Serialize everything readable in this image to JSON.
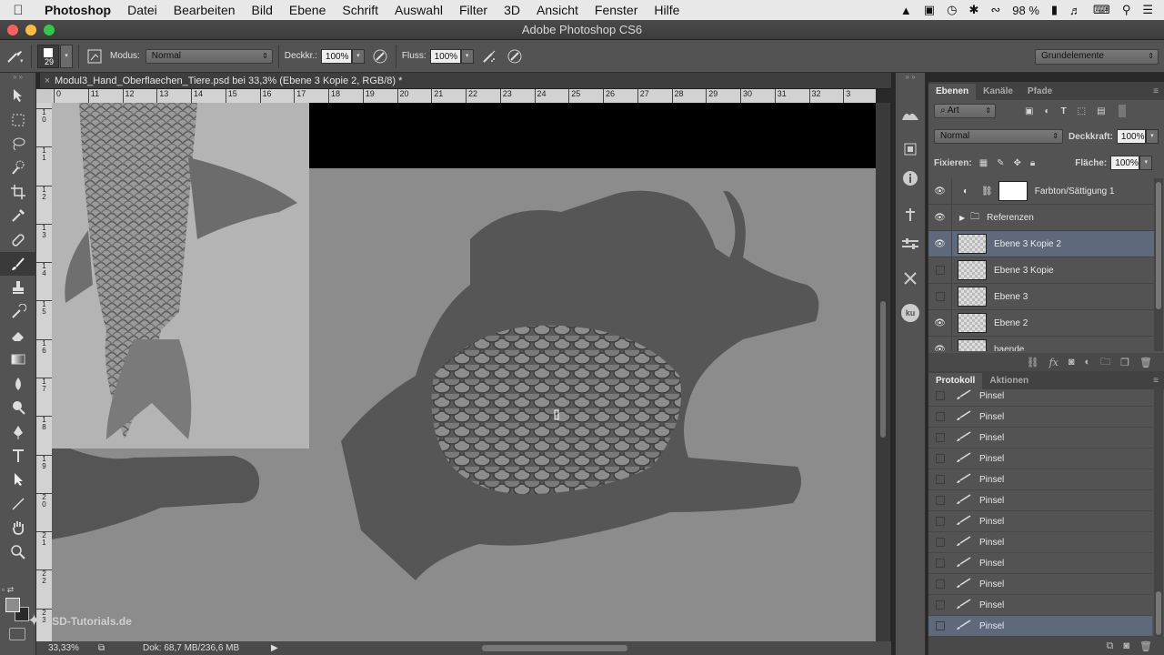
{
  "menubar": {
    "app_name": "Photoshop",
    "items": [
      "Datei",
      "Bearbeiten",
      "Bild",
      "Ebene",
      "Schrift",
      "Auswahl",
      "Filter",
      "3D",
      "Ansicht",
      "Fenster",
      "Hilfe"
    ],
    "battery": "98 %"
  },
  "window": {
    "title": "Adobe Photoshop CS6",
    "light_colors": [
      "#fc605c",
      "#fdbc40",
      "#34c84a"
    ]
  },
  "options": {
    "brush_size": "29",
    "mode_label": "Modus:",
    "mode_value": "Normal",
    "opacity_label": "Deckkr.:",
    "opacity_value": "100%",
    "flow_label": "Fluss:",
    "flow_value": "100%",
    "workspace": "Grundelemente"
  },
  "document": {
    "tab_title": "Modul3_Hand_Oberflaechen_Tiere.psd bei 33,3% (Ebene 3 Kopie 2, RGB/8) *",
    "ruler_h": [
      "0",
      "11",
      "12",
      "13",
      "14",
      "15",
      "16",
      "17",
      "18",
      "19",
      "20",
      "21",
      "22",
      "23",
      "24",
      "25",
      "26",
      "27",
      "28",
      "29",
      "30",
      "31",
      "32",
      "3"
    ],
    "ruler_v": [
      "1\n0",
      "1\n1",
      "1\n2",
      "1\n3",
      "1\n4",
      "1\n5",
      "1\n6",
      "1\n7",
      "1\n8",
      "1\n9",
      "2\n0",
      "2\n1",
      "2\n2",
      "2\n3"
    ]
  },
  "status": {
    "zoom": "33,33%",
    "doc_info": "Dok: 68,7 MB/236,6 MB"
  },
  "layers_panel": {
    "tabs": [
      "Ebenen",
      "Kanäle",
      "Pfade"
    ],
    "filter_kind": "Art",
    "blend_mode": "Normal",
    "opacity_label": "Deckkraft:",
    "opacity_value": "100%",
    "lock_label": "Fixieren:",
    "fill_label": "Fläche:",
    "fill_value": "100%",
    "layers": [
      {
        "name": "Farbton/Sättigung 1",
        "visible": true,
        "type": "adjustment"
      },
      {
        "name": "Referenzen",
        "visible": true,
        "type": "group"
      },
      {
        "name": "Ebene 3 Kopie 2",
        "visible": true,
        "type": "pixel",
        "selected": true
      },
      {
        "name": "Ebene 3 Kopie",
        "visible": false,
        "type": "pixel"
      },
      {
        "name": "Ebene 3",
        "visible": false,
        "type": "pixel"
      },
      {
        "name": "Ebene 2",
        "visible": true,
        "type": "pixel"
      },
      {
        "name": "haende",
        "visible": true,
        "type": "pixel"
      }
    ]
  },
  "history_panel": {
    "tabs": [
      "Protokoll",
      "Aktionen"
    ],
    "items": [
      "Pinsel",
      "Pinsel",
      "Pinsel",
      "Pinsel",
      "Pinsel",
      "Pinsel",
      "Pinsel",
      "Pinsel",
      "Pinsel",
      "Pinsel",
      "Pinsel",
      "Pinsel"
    ]
  },
  "watermark": "PSD-Tutorials.de",
  "strip_labels": {
    "ku": "ku"
  },
  "icons": {
    "toolbar": [
      "move-icon",
      "marquee-icon",
      "lasso-icon",
      "quick-select-icon",
      "crop-icon",
      "eyedropper-icon",
      "healing-brush-icon",
      "brush-icon",
      "clone-stamp-icon",
      "history-brush-icon",
      "eraser-icon",
      "gradient-icon",
      "blur-icon",
      "dodge-icon",
      "pen-icon",
      "type-icon",
      "path-select-icon",
      "line-icon",
      "hand-icon",
      "zoom-icon"
    ]
  }
}
